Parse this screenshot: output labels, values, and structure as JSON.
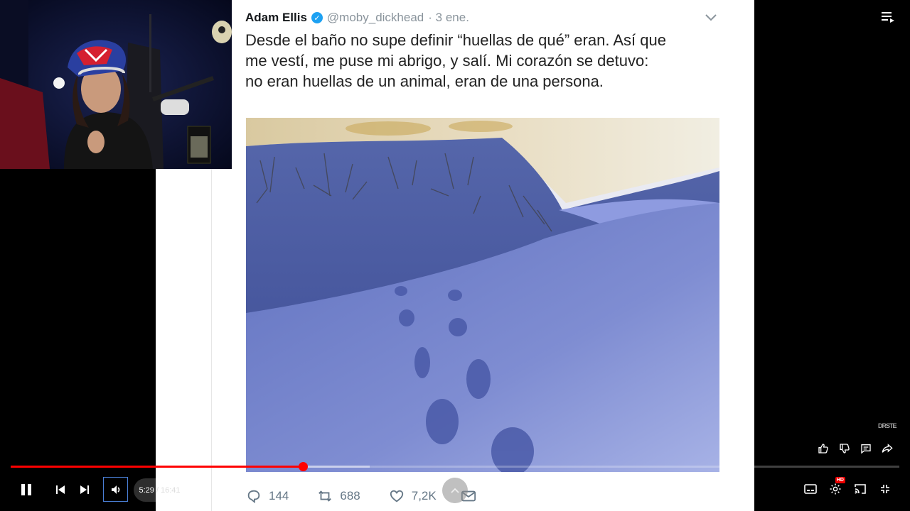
{
  "tweet": {
    "author": "Adam Ellis",
    "handle": "@moby_dickhead",
    "date": "· 3 ene.",
    "lines": [
      "Desde el baño no supe definir “huellas de qué” eran. Así que",
      "me vestí, me puse mi abrigo, y salí. Mi corazón se detuvo:",
      "no eran huellas de un animal, eran de una persona."
    ],
    "replies": "144",
    "retweets": "688",
    "likes": "7,2K"
  },
  "player": {
    "current_time": "5:29",
    "separator": "/",
    "duration": "16:41",
    "progress_fraction": 0.329,
    "buffer_fraction": 0.404,
    "hd_label": "HD",
    "watermark": "DRSTE",
    "accent_color": "#ff0000"
  },
  "icons": {
    "play_state": "pause-icon",
    "prev": "previous-icon",
    "next": "next-icon",
    "volume": "volume-icon",
    "collapse": "chevron-up-icon",
    "like": "thumbs-up-icon",
    "dislike": "thumbs-down-icon",
    "comments": "comment-icon",
    "share": "share-icon",
    "queue": "queue-icon",
    "captions": "captions-icon",
    "settings": "gear-icon",
    "cast": "cast-icon",
    "exit_fullscreen": "exit-fullscreen-icon"
  }
}
